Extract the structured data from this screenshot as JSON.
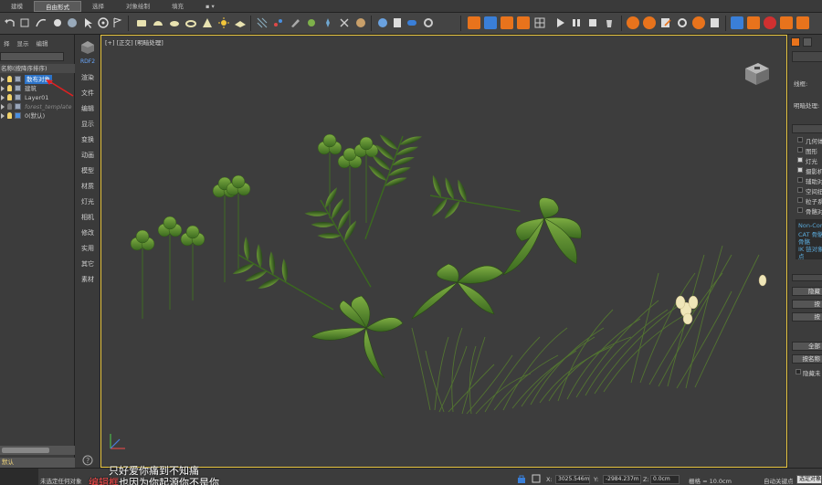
{
  "menubar": {
    "tabs": [
      {
        "label": "建模",
        "active": false
      },
      {
        "label": "自由形式",
        "active": true
      },
      {
        "label": "选择",
        "active": false
      },
      {
        "label": "对象绘制",
        "active": false
      },
      {
        "label": "填充",
        "active": false
      }
    ]
  },
  "explorer": {
    "tabs": [
      "择",
      "显示",
      "编辑"
    ],
    "header": "名称(按降序排序)",
    "rows": [
      {
        "label": "散布对象",
        "selected": true,
        "dim": false
      },
      {
        "label": "建筑",
        "selected": false,
        "dim": false
      },
      {
        "label": "Layer01",
        "selected": false,
        "dim": false
      },
      {
        "label": "forest_template",
        "selected": false,
        "dim": true
      },
      {
        "label": "0(默认)",
        "selected": false,
        "dim": false
      }
    ],
    "layer_bar": "默认"
  },
  "command_strip": {
    "items": [
      "RDF2",
      "渲染",
      "文件",
      "编辑",
      "显示",
      "变换",
      "动画",
      "模型",
      "材质",
      "灯光",
      "相机",
      "修改",
      "实用",
      "其它",
      "素材"
    ]
  },
  "viewport": {
    "label": "[+] [正交] [明暗处理]"
  },
  "right_panel": {
    "label_lines": "线框:",
    "label_shading": "明暗处理:",
    "checks": [
      {
        "label": "几何体",
        "checked": false
      },
      {
        "label": "图形",
        "checked": false
      },
      {
        "label": "灯光",
        "checked": true
      },
      {
        "label": "摄影机",
        "checked": true
      },
      {
        "label": "辅助对象",
        "checked": false
      },
      {
        "label": "空间扭曲",
        "checked": false
      },
      {
        "label": "粒子系统",
        "checked": false
      },
      {
        "label": "骨骼对象",
        "checked": false
      }
    ],
    "info_lines": [
      "Non-Cor",
      "CAT 骨骼",
      "骨骼",
      "IK 链对象",
      "点"
    ],
    "buttons": [
      "隐藏",
      "按",
      "按",
      "全部",
      "按名称",
      "隐藏未"
    ]
  },
  "statusbar": {
    "message": "未选定任何对象",
    "lyrics_top": "只好爱你痛到不知痛",
    "lyrics_bottom_highlight": "编辑框",
    "lyrics_bottom_rest": "也因为你起源你不是你",
    "x_label": "X:",
    "x_value": "3025.546m",
    "y_label": "Y:",
    "y_value": "-2984.237m",
    "z_label": "Z:",
    "z_value": "0.0cm",
    "grid_label": "栅格 = 10.0cm",
    "autokey_label": "自动关键点",
    "selected_btn": "选定对象"
  },
  "colors": {
    "selection": "#2c73c8",
    "viewport_border": "#e9c742",
    "toolbar_orange": "#e8731c",
    "toolbar_blue": "#3a7fd8"
  }
}
